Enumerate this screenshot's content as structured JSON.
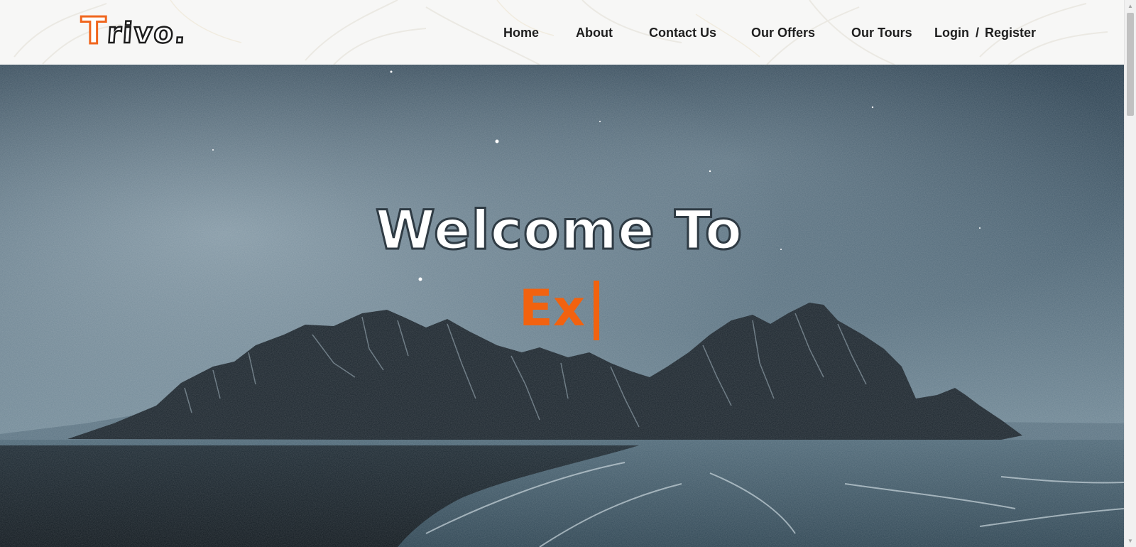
{
  "header": {
    "logo_first": "T",
    "logo_rest": "rivo.",
    "nav": {
      "home": "Home",
      "about": "About",
      "contact": "Contact Us",
      "offers": "Our Offers",
      "tours": "Our Tours",
      "login": "Login",
      "separator": "/",
      "register": "Register"
    }
  },
  "hero": {
    "title": "Welcome To",
    "typed_text": "Ex"
  },
  "colors": {
    "accent": "#f2620f",
    "nav_text": "#1f1f1f",
    "header_bg": "#f7f7f6"
  },
  "icons": [
    "scroll-up-arrow-icon",
    "scroll-down-arrow-icon",
    "text-cursor-icon"
  ]
}
